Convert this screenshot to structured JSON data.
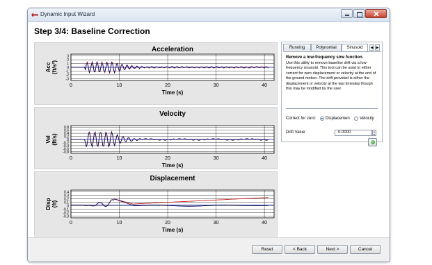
{
  "window": {
    "title": "Dynamic Input Wizard",
    "heading": "Step 3/4: Baseline Correction"
  },
  "plots": [
    {
      "title": "Acceleration",
      "ylabel_line1": "Acc",
      "ylabel_line2": "(ft/s²)",
      "xlabel": "Time (s)",
      "yticks": [
        "3",
        "2",
        "1",
        "0",
        "-1",
        "-2",
        "-3"
      ]
    },
    {
      "title": "Velocity",
      "ylabel_line1": "Vel",
      "ylabel_line2": "(ft/s)",
      "xlabel": "Time (s)",
      "yticks": [
        "0.8",
        "0.6",
        "0.4",
        "0.2",
        "0",
        "-0.2",
        "-0.4",
        "-0.6",
        "-0.8"
      ]
    },
    {
      "title": "Displacement",
      "ylabel_line1": "Disp",
      "ylabel_line2": "(ft)",
      "xlabel": "Time (s)",
      "yticks": [
        "0.4",
        "0.3",
        "0.2",
        "0.1",
        "0",
        "-0.1",
        "-0.2",
        "-0.3"
      ]
    }
  ],
  "xticks": [
    "0",
    "10",
    "20",
    "30",
    "40"
  ],
  "tabs": [
    "Running",
    "Polynomial",
    "Sinusoid"
  ],
  "tab_arrows": [
    "◀",
    "▶"
  ],
  "sinusoid": {
    "title": "Remove a low-frequency sine function.",
    "description": "Use this utility to remove baseline drift via a low-frequency sinusoid. This tool can be used to either correct for zero displacement or velocity at the end of the ground motion. The drift provided is either the displacement or velocity at the last timestep though this may be modified by the user.",
    "correct_for_label": "Correct for zero:",
    "option_displacement": "Displacemen",
    "option_velocity": "Velocity",
    "selected": "Displacemen",
    "drift_label": "Drift Value",
    "drift_value": "0.0000"
  },
  "buttons": {
    "reset": "Reset",
    "back": "< Back",
    "next": "Next >",
    "cancel": "Cancel"
  },
  "colors": {
    "raw_series": "#cc2222",
    "corrected_series": "#101060",
    "zero_line": "#2a3cc8"
  }
}
